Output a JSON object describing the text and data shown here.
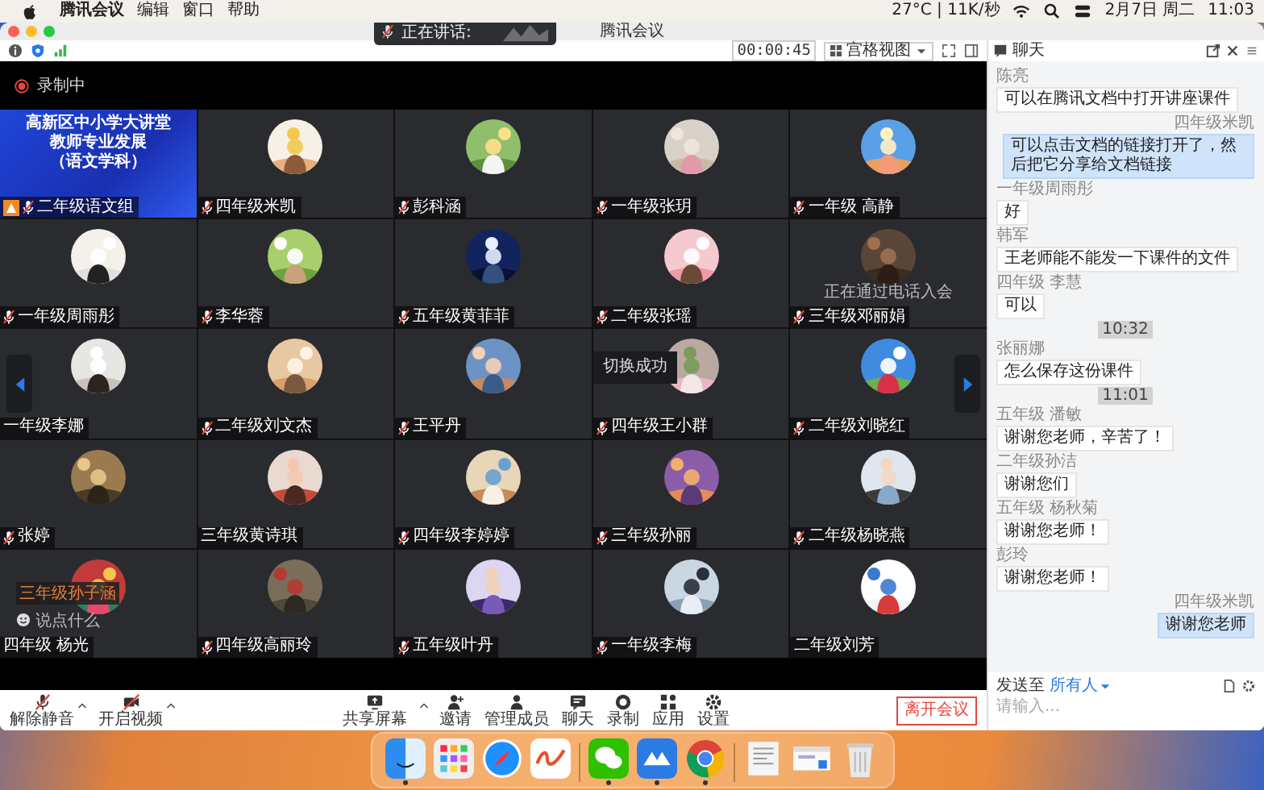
{
  "menu_bar": {
    "app_menus": [
      "腾讯会议",
      "编辑",
      "窗口",
      "帮助"
    ],
    "status": "27°C | 11K/秒",
    "date": "2月7日 周二",
    "time": "11:03"
  },
  "window": {
    "title": "腾讯会议"
  },
  "speaking_toast": {
    "label": "正在讲话:"
  },
  "top_bar": {
    "timer": "00:00:45",
    "view": "宫格视图"
  },
  "recording": {
    "label": "录制中"
  },
  "tiles": [
    {
      "kind": "slide",
      "name": "二年级语文组",
      "lines": [
        "高新区中小学大讲堂",
        "教师专业发展",
        "（语文学科）"
      ]
    },
    {
      "kind": "avatar",
      "name": "四年级米凯",
      "muted": true
    },
    {
      "kind": "avatar",
      "name": "彭科涵",
      "muted": true
    },
    {
      "kind": "avatar",
      "name": "一年级张玥",
      "muted": true
    },
    {
      "kind": "avatar",
      "name": "一年级 高静",
      "muted": true
    },
    {
      "kind": "avatar",
      "name": "一年级周雨彤",
      "muted": true
    },
    {
      "kind": "avatar",
      "name": "李华蓉",
      "muted": true
    },
    {
      "kind": "avatar",
      "name": "五年级黄菲菲",
      "muted": true
    },
    {
      "kind": "avatar",
      "name": "二年级张瑶",
      "muted": true
    },
    {
      "kind": "avatar",
      "name": "三年级邓丽娟",
      "muted": true,
      "note": "正在通过电话入会"
    },
    {
      "kind": "avatar",
      "name": "一年级李娜",
      "muted": false
    },
    {
      "kind": "avatar",
      "name": "二年级刘文杰",
      "muted": true
    },
    {
      "kind": "avatar",
      "name": "王平丹",
      "muted": true
    },
    {
      "kind": "avatar",
      "name": "四年级王小群",
      "muted": true,
      "toast": "切换成功"
    },
    {
      "kind": "avatar",
      "name": "二年级刘晓红",
      "muted": true
    },
    {
      "kind": "avatar",
      "name": "张婷",
      "muted": true
    },
    {
      "kind": "avatar",
      "name": "三年级黄诗琪",
      "muted": false
    },
    {
      "kind": "avatar",
      "name": "四年级李婷婷",
      "muted": true
    },
    {
      "kind": "avatar",
      "name": "三年级孙丽",
      "muted": true
    },
    {
      "kind": "avatar",
      "name": "二年级杨晓燕",
      "muted": true
    },
    {
      "kind": "avatar",
      "name": "四年级 杨光",
      "muted": false,
      "bubble": {
        "name": "三年级孙子涵",
        "text": "说点什么"
      }
    },
    {
      "kind": "avatar",
      "name": "四年级高丽玲",
      "muted": true
    },
    {
      "kind": "avatar",
      "name": "五年级叶丹",
      "muted": true
    },
    {
      "kind": "avatar",
      "name": "一年级李梅",
      "muted": true
    },
    {
      "kind": "avatar",
      "name": "二年级刘芳",
      "muted": false
    }
  ],
  "bottom_bar": {
    "left_controls": [
      "解除静音",
      "开启视频"
    ],
    "controls": [
      "共享屏幕",
      "邀请",
      "管理成员",
      "聊天",
      "录制",
      "应用",
      "设置"
    ],
    "leave_button": "离开会议"
  },
  "chat": {
    "title": "聊天",
    "items": [
      {
        "kind": "message",
        "sender": "陈亮",
        "text": "可以在腾讯文档中打开讲座课件",
        "mine": false
      },
      {
        "kind": "message",
        "sender": "四年级米凯",
        "text": "可以点击文档的链接打开了，然后把它分享给文档链接",
        "mine": true
      },
      {
        "kind": "message",
        "sender": "一年级周雨彤",
        "text": "好",
        "mine": false
      },
      {
        "kind": "message",
        "sender": "韩军",
        "text": "王老师能不能发一下课件的文件",
        "mine": false
      },
      {
        "kind": "message",
        "sender": "四年级 李慧",
        "text": "可以",
        "mine": false
      },
      {
        "kind": "time",
        "text": "10:32"
      },
      {
        "kind": "message",
        "sender": "张丽娜",
        "text": "怎么保存这份课件",
        "mine": false
      },
      {
        "kind": "time",
        "text": "11:01"
      },
      {
        "kind": "message",
        "sender": "五年级 潘敏",
        "text": "谢谢您老师，辛苦了！",
        "mine": false
      },
      {
        "kind": "message",
        "sender": "二年级孙洁",
        "text": "谢谢您们",
        "mine": false
      },
      {
        "kind": "message",
        "sender": "五年级 杨秋菊",
        "text": "谢谢您老师！",
        "mine": false
      },
      {
        "kind": "message",
        "sender": "彭玲",
        "text": "谢谢您老师！",
        "mine": false
      },
      {
        "kind": "message",
        "sender": "四年级米凯",
        "text": "谢谢您老师",
        "mine": true
      }
    ],
    "send_to_label": "发送至",
    "send_to": "所有人",
    "placeholder": "请输入..."
  },
  "dock": [
    {
      "running": true
    },
    {
      "running": false
    },
    {
      "running": false
    },
    {
      "running": false
    },
    {
      "running": true
    },
    {
      "running": true
    },
    {
      "running": true
    },
    {
      "running": false
    },
    {
      "running": false
    },
    {
      "running": false
    }
  ]
}
